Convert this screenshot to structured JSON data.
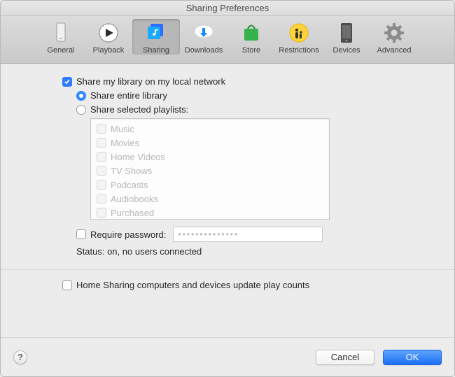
{
  "window": {
    "title": "Sharing Preferences"
  },
  "toolbar": {
    "items": [
      {
        "label": "General",
        "icon": "general-icon"
      },
      {
        "label": "Playback",
        "icon": "play-icon"
      },
      {
        "label": "Sharing",
        "icon": "sharing-icon",
        "selected": true
      },
      {
        "label": "Downloads",
        "icon": "download-icon"
      },
      {
        "label": "Store",
        "icon": "store-icon"
      },
      {
        "label": "Restrictions",
        "icon": "restrictions-icon"
      },
      {
        "label": "Devices",
        "icon": "devices-icon"
      },
      {
        "label": "Advanced",
        "icon": "gear-icon"
      }
    ]
  },
  "share": {
    "share_library_label": "Share my library on my local network",
    "share_library_checked": true,
    "radio_entire_label": "Share entire library",
    "radio_selected_label": "Share selected playlists:",
    "radio_value": "entire",
    "playlists": [
      "Music",
      "Movies",
      "Home Videos",
      "TV Shows",
      "Podcasts",
      "Audiobooks",
      "Purchased"
    ],
    "require_password_label": "Require password:",
    "require_password_checked": false,
    "password_mask": "••••••••••••••",
    "status_label": "Status: on, no users connected"
  },
  "home_sharing": {
    "label": "Home Sharing computers and devices update play counts",
    "checked": false
  },
  "footer": {
    "help": "?",
    "cancel": "Cancel",
    "ok": "OK"
  }
}
